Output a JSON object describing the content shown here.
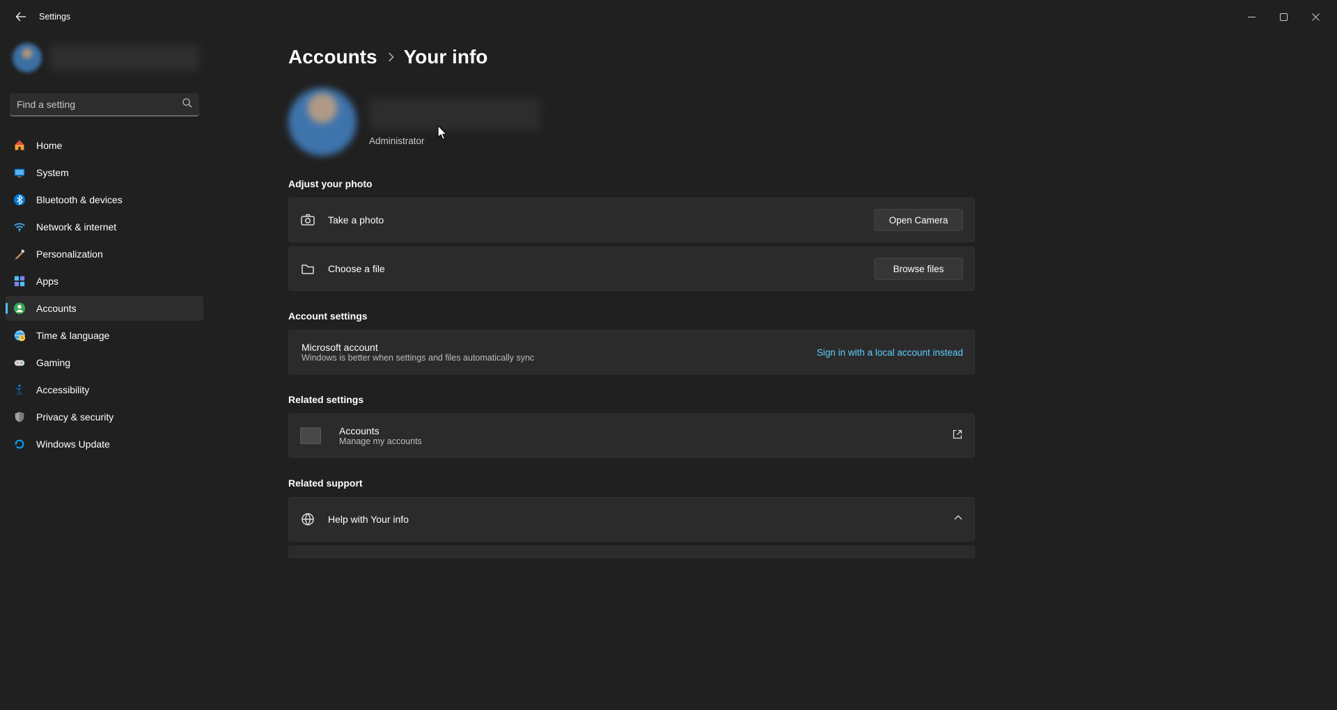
{
  "window": {
    "title": "Settings"
  },
  "search": {
    "placeholder": "Find a setting"
  },
  "nav": {
    "home": "Home",
    "system": "System",
    "bluetooth": "Bluetooth & devices",
    "network": "Network & internet",
    "personalization": "Personalization",
    "apps": "Apps",
    "accounts": "Accounts",
    "time": "Time & language",
    "gaming": "Gaming",
    "accessibility": "Accessibility",
    "privacy": "Privacy & security",
    "update": "Windows Update"
  },
  "breadcrumb": {
    "parent": "Accounts",
    "current": "Your info"
  },
  "profile": {
    "role": "Administrator"
  },
  "sections": {
    "adjust_photo": "Adjust your photo",
    "account_settings": "Account settings",
    "related_settings": "Related settings",
    "related_support": "Related support"
  },
  "photo": {
    "take_label": "Take a photo",
    "take_button": "Open Camera",
    "choose_label": "Choose a file",
    "choose_button": "Browse files"
  },
  "account_settings_card": {
    "title": "Microsoft account",
    "sub": "Windows is better when settings and files automatically sync",
    "action": "Sign in with a local account instead"
  },
  "related": {
    "accounts_title": "Accounts",
    "accounts_sub": "Manage my accounts"
  },
  "support": {
    "help_title": "Help with Your info"
  }
}
